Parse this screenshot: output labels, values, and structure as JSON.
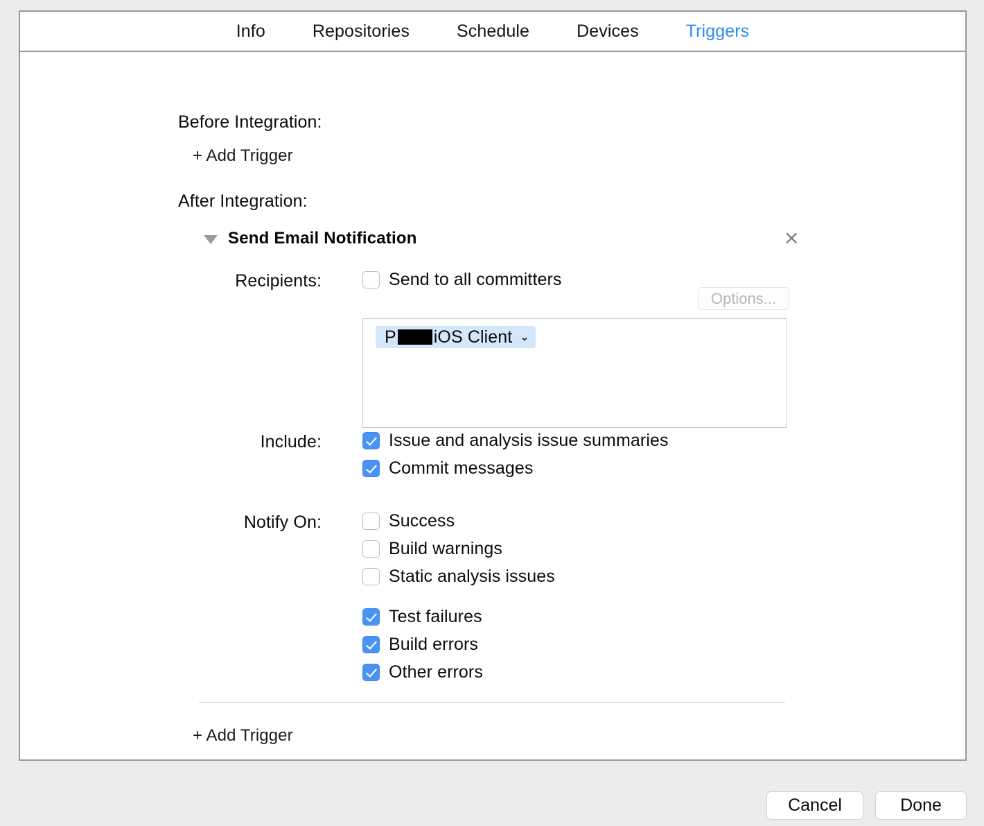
{
  "window": {
    "tabs": [
      {
        "label": "Info",
        "active": false
      },
      {
        "label": "Repositories",
        "active": false
      },
      {
        "label": "Schedule",
        "active": false
      },
      {
        "label": "Devices",
        "active": false
      },
      {
        "label": "Triggers",
        "active": true
      }
    ]
  },
  "sections": {
    "before_integration": {
      "heading": "Before Integration:",
      "add_trigger_label": "+ Add Trigger"
    },
    "after_integration": {
      "heading": "After Integration:",
      "add_trigger_label": "+ Add Trigger"
    }
  },
  "trigger": {
    "title": "Send Email Notification",
    "disclosure_state": "expanded",
    "close_label": "×",
    "recipients": {
      "label": "Recipients:",
      "send_to_all_committers": {
        "label": "Send to all committers",
        "checked": false
      },
      "options_button": {
        "label": "Options...",
        "enabled": false
      },
      "tokens": [
        {
          "prefix": "P",
          "redacted": true,
          "suffix": "iOS Client",
          "chevron": "⌄"
        }
      ]
    },
    "include": {
      "label": "Include:",
      "items": [
        {
          "label": "Issue and analysis issue summaries",
          "checked": true
        },
        {
          "label": "Commit messages",
          "checked": true
        }
      ]
    },
    "notify_on": {
      "label": "Notify On:",
      "group_one": [
        {
          "label": "Success",
          "checked": false
        },
        {
          "label": "Build warnings",
          "checked": false
        },
        {
          "label": "Static analysis issues",
          "checked": false
        }
      ],
      "group_two": [
        {
          "label": "Test failures",
          "checked": true
        },
        {
          "label": "Build errors",
          "checked": true
        },
        {
          "label": "Other errors",
          "checked": true
        }
      ]
    }
  },
  "footer": {
    "cancel_label": "Cancel",
    "done_label": "Done"
  },
  "colors": {
    "accent_blue": "#2e8ded",
    "checkbox_blue": "#4a93f5",
    "token_blue": "#d4e6fa",
    "window_background": "#ececec",
    "panel_border": "#9a9a9a"
  }
}
